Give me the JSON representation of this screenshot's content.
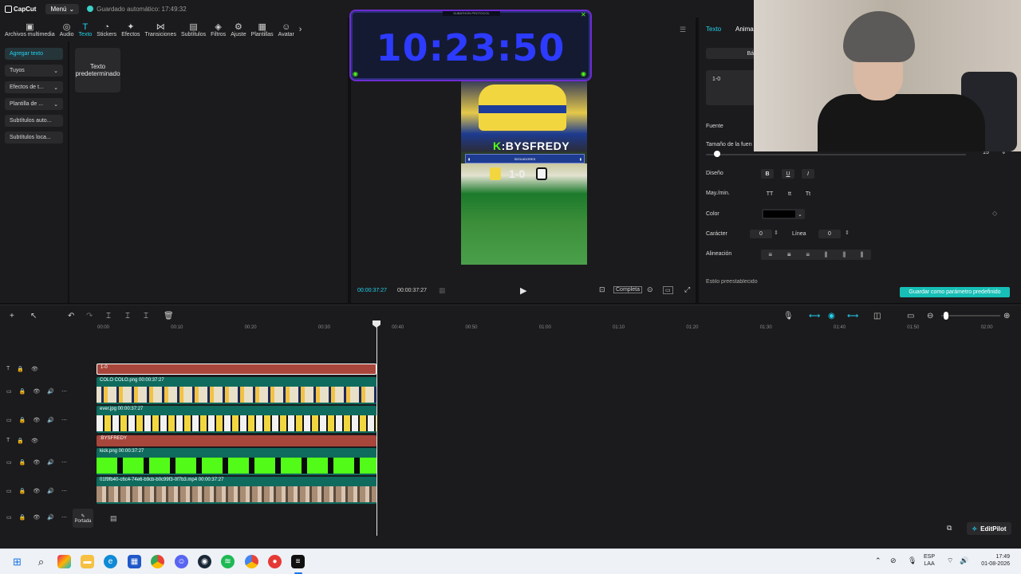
{
  "app": {
    "name": "CapCut",
    "menu": "Menú",
    "autosave": "Guardado automático: 17:49:32"
  },
  "toolbar": [
    {
      "label": "Archivos multimedia",
      "icon": "media-icon"
    },
    {
      "label": "Audio",
      "icon": "audio-icon"
    },
    {
      "label": "Texto",
      "icon": "text-icon",
      "active": true
    },
    {
      "label": "Stickers",
      "icon": "sticker-icon"
    },
    {
      "label": "Efectos",
      "icon": "effects-icon"
    },
    {
      "label": "Transiciones",
      "icon": "transitions-icon"
    },
    {
      "label": "Subtítulos",
      "icon": "subtitles-icon"
    },
    {
      "label": "Filtros",
      "icon": "filters-icon"
    },
    {
      "label": "Ajuste",
      "icon": "adjust-icon"
    },
    {
      "label": "Plantillas",
      "icon": "templates-icon"
    },
    {
      "label": "Avatar",
      "icon": "avatar-icon"
    }
  ],
  "leftnav": [
    {
      "label": "Agregar texto",
      "active": true
    },
    {
      "label": "Tuyos",
      "dropdown": true
    },
    {
      "label": "Efectos de t...",
      "dropdown": true
    },
    {
      "label": "Plantilla de ...",
      "dropdown": true
    },
    {
      "label": "Subtítulos auto..."
    },
    {
      "label": "Subtítulos loca..."
    }
  ],
  "preset_card": "Texto predeterminado",
  "player": {
    "current_time": "00:00:37:27",
    "total_time": "00:00:37:27",
    "ratio_label": "Completa",
    "overlay_brand": "BYSFREDY",
    "overlay_score": "1-0",
    "scorebar_label": "SEGUIDORES"
  },
  "timer": {
    "time": "10:23:50",
    "caption": "SUBATHON PROTOCOL"
  },
  "inspector": {
    "tabs": [
      "Texto",
      "Anima"
    ],
    "basic_label": "Bá",
    "text_value": "1-0",
    "font_label": "Fuente",
    "size_label": "Tamaño de la fuen",
    "size_value": "15",
    "design_label": "Diseño",
    "case_label": "May./min.",
    "color_label": "Color",
    "color_value": "#000000",
    "char_label": "Carácter",
    "char_value": "0",
    "line_label": "Línea",
    "line_value": "0",
    "align_label": "Alineación",
    "preset_label": "Estilo preestablecido",
    "save_button": "Guardar como parámetro predefinido"
  },
  "ruler": [
    "00:00",
    "00:10",
    "00:20",
    "00:30",
    "00:40",
    "00:50",
    "01:00",
    "01:10",
    "01:20",
    "01:30",
    "01:40",
    "01:50",
    "02:00"
  ],
  "tracks": [
    {
      "type": "text",
      "label": "1-0"
    },
    {
      "type": "media",
      "label": "COLO COLO.png   00:00:37:27",
      "pattern": "colo"
    },
    {
      "type": "media",
      "label": "ever.jpg   00:00:37:27",
      "pattern": "ever"
    },
    {
      "type": "text",
      "label": ":BYSFREDY"
    },
    {
      "type": "media",
      "label": "kick.png   00:00:37:27",
      "pattern": "kick"
    },
    {
      "type": "media",
      "label": "01f9fb40-c6c4-74e6-b9cb-b0c99f3-0f7b3.mp4   00:00:37:27",
      "pattern": "video"
    }
  ],
  "cover_label": "Portada",
  "editpilot": "EditPilot",
  "taskbar": {
    "lang": "ESP",
    "layout": "LAA",
    "time": "17:49",
    "date": "01-08-2026"
  }
}
